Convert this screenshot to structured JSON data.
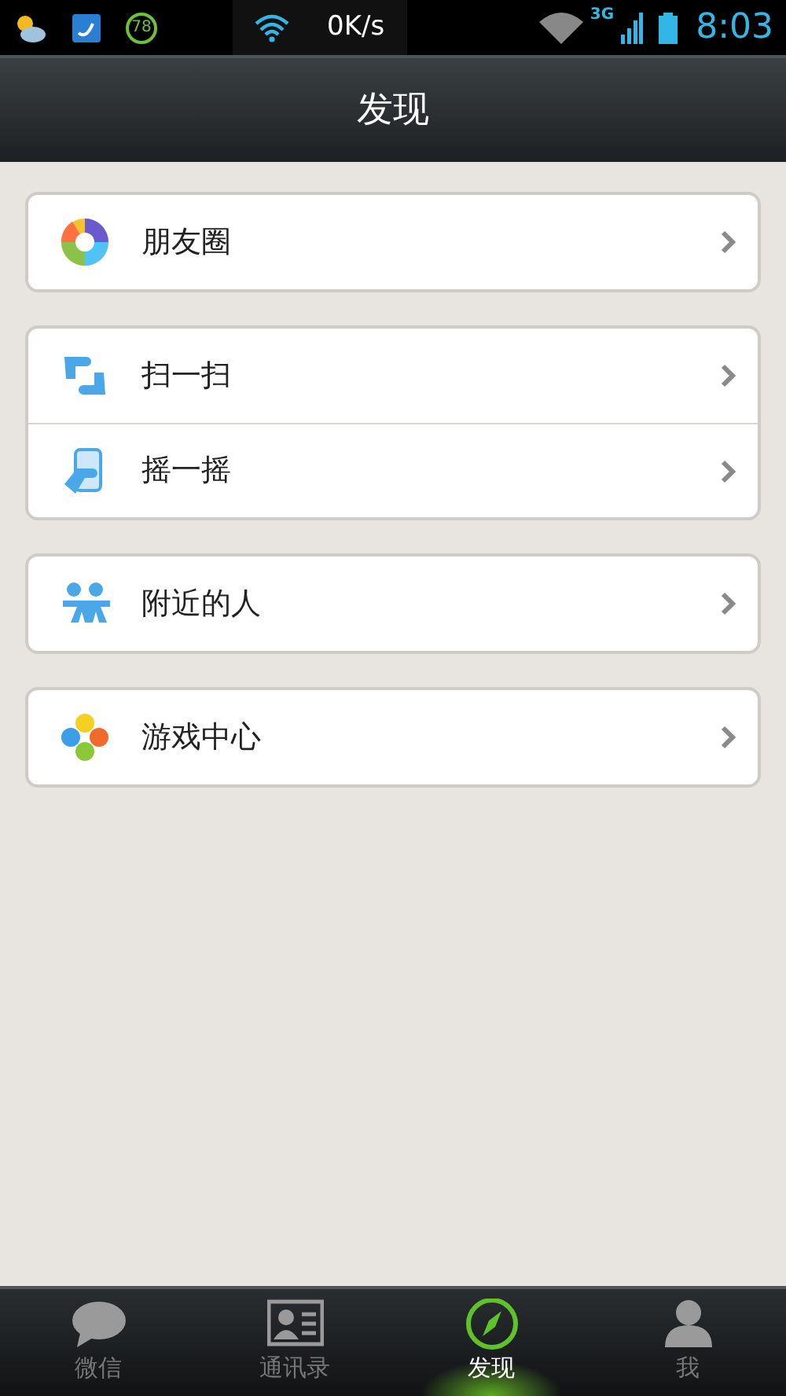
{
  "status_bar": {
    "notification_badge": "78",
    "network_speed": "0K/s",
    "network_type": "3G",
    "time": "8:03"
  },
  "header": {
    "title": "发现"
  },
  "groups": [
    {
      "items": [
        {
          "label": "朋友圈",
          "kind": "moments"
        }
      ]
    },
    {
      "items": [
        {
          "label": "扫一扫",
          "kind": "scan"
        },
        {
          "label": "摇一摇",
          "kind": "shake"
        }
      ]
    },
    {
      "items": [
        {
          "label": "附近的人",
          "kind": "nearby"
        }
      ]
    },
    {
      "items": [
        {
          "label": "游戏中心",
          "kind": "games"
        }
      ]
    }
  ],
  "tabs": [
    {
      "label": "微信",
      "kind": "chat",
      "selected": false
    },
    {
      "label": "通讯录",
      "kind": "contacts",
      "selected": false
    },
    {
      "label": "发现",
      "kind": "discover",
      "selected": true
    },
    {
      "label": "我",
      "kind": "me",
      "selected": false
    }
  ]
}
